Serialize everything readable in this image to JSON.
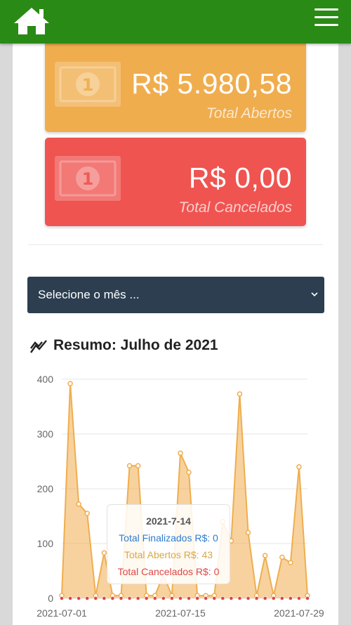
{
  "header": {
    "home_icon": "home-icon",
    "menu_icon": "hamburger-menu-icon",
    "color": "#2a8a16"
  },
  "cards": {
    "open": {
      "amount": "R$ 5.980,58",
      "label": "Total Abertos",
      "color": "#f0ad4e",
      "icon": "banknote-icon"
    },
    "cancelled": {
      "amount": "R$ 0,00",
      "label": "Total Cancelados",
      "color": "#ef5450",
      "icon": "banknote-icon"
    }
  },
  "month_select": {
    "selected": "Selecione o mês ..."
  },
  "summary": {
    "title": "Resumo: Julho de 2021",
    "icon": "trending-chart-icon"
  },
  "tooltip": {
    "title": "2021-7-14",
    "finalizados": "Total Finalizados R$: 0",
    "abertos": "Total Abertos R$: 43",
    "cancelados": "Total Cancelados R$: 0"
  },
  "chart_data": {
    "type": "area",
    "ylim": [
      0,
      400
    ],
    "yticks": [
      0,
      100,
      200,
      300,
      400
    ],
    "xtick_labels": [
      "2021-07-01",
      "2021-07-15",
      "2021-07-29"
    ],
    "x": [
      "2021-07-01",
      "2021-07-02",
      "2021-07-03",
      "2021-07-04",
      "2021-07-05",
      "2021-07-06",
      "2021-07-07",
      "2021-07-08",
      "2021-07-09",
      "2021-07-10",
      "2021-07-11",
      "2021-07-12",
      "2021-07-13",
      "2021-07-14",
      "2021-07-15",
      "2021-07-16",
      "2021-07-17",
      "2021-07-18",
      "2021-07-19",
      "2021-07-20",
      "2021-07-21",
      "2021-07-22",
      "2021-07-23",
      "2021-07-24",
      "2021-07-25",
      "2021-07-26",
      "2021-07-27",
      "2021-07-28",
      "2021-07-29",
      "2021-07-30"
    ],
    "grid": true,
    "legend": "none",
    "series": [
      {
        "name": "Total Finalizados",
        "color": "#2e7bcf",
        "values": [
          0,
          0,
          0,
          0,
          0,
          0,
          0,
          0,
          0,
          0,
          0,
          0,
          0,
          0,
          0,
          0,
          0,
          0,
          0,
          0,
          0,
          0,
          0,
          0,
          0,
          0,
          0,
          0,
          0,
          0
        ]
      },
      {
        "name": "Total Abertos",
        "color": "#f0ad4e",
        "values": [
          5,
          392,
          172,
          155,
          5,
          83,
          5,
          5,
          242,
          242,
          5,
          5,
          43,
          5,
          265,
          230,
          5,
          5,
          5,
          140,
          105,
          373,
          120,
          5,
          78,
          5,
          75,
          65,
          240,
          5
        ]
      },
      {
        "name": "Total Cancelados",
        "color": "#e04545",
        "values": [
          0,
          0,
          0,
          0,
          0,
          0,
          0,
          0,
          0,
          0,
          0,
          0,
          0,
          0,
          0,
          0,
          0,
          0,
          0,
          0,
          0,
          0,
          0,
          0,
          0,
          0,
          0,
          0,
          0,
          0
        ]
      }
    ]
  }
}
